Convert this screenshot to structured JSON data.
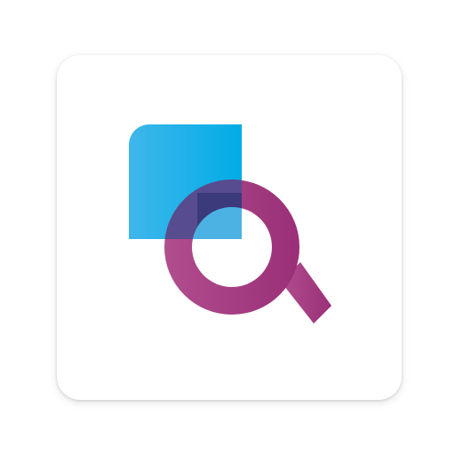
{
  "app_icon": {
    "icon": "search-document-app-icon",
    "colors": {
      "tile_background": "#ffffff",
      "square_light": "#3FB7EB",
      "square_dark": "#00ACE6",
      "overlap_blue": "#4BB2E3",
      "magnifier_light": "#B14E8E",
      "magnifier_dark": "#9A2F77",
      "overlap_top": "#3B3A7A",
      "overlap_left": "#564C8E"
    }
  }
}
